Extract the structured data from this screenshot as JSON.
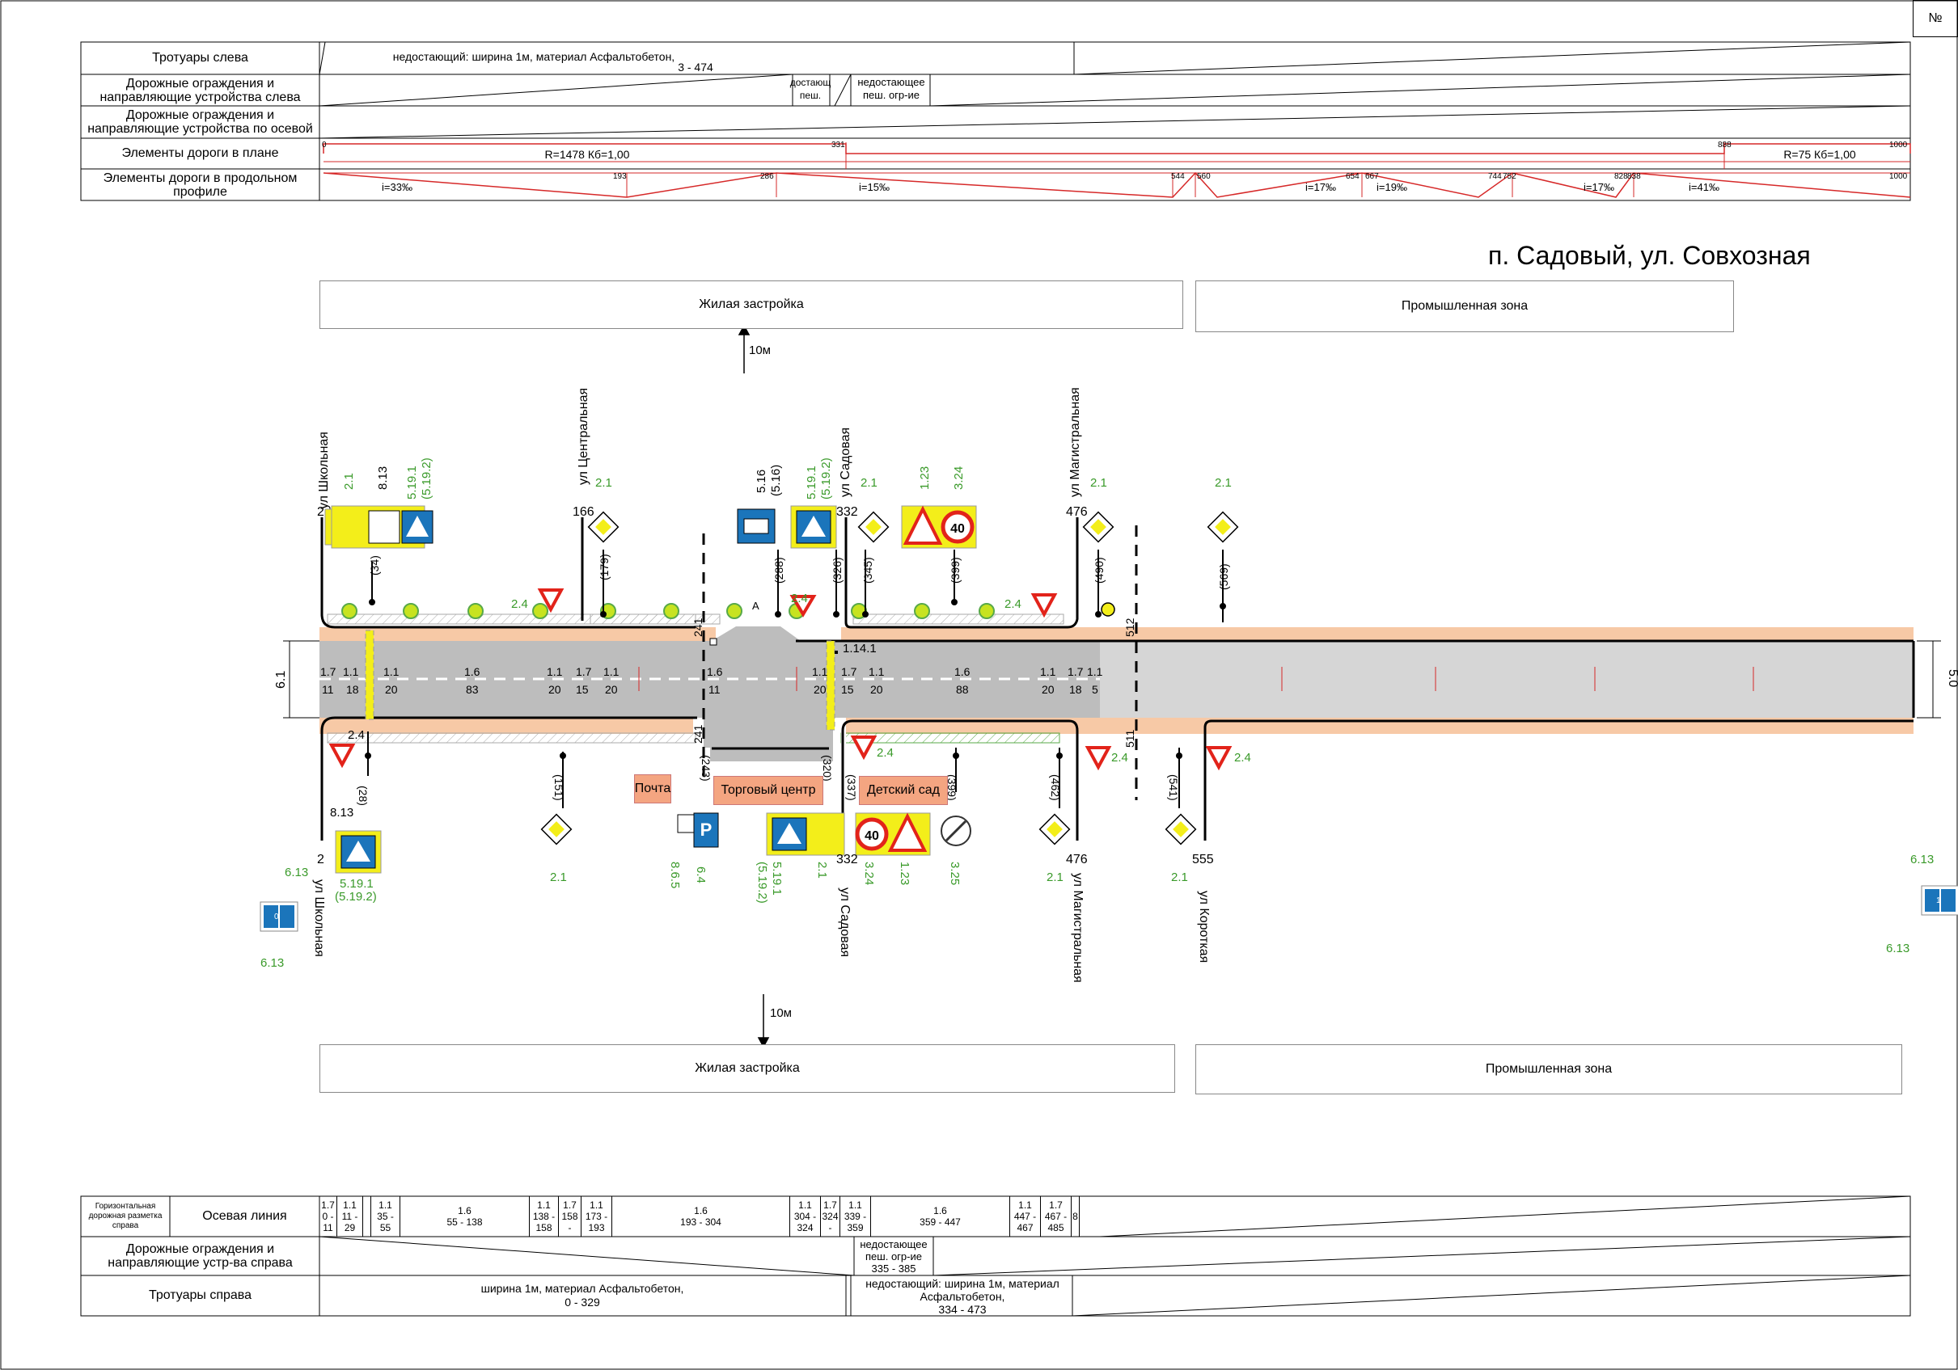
{
  "corner_number": "№",
  "title": "п. Садовый, ул. Совхозная",
  "top_table": {
    "rows": [
      {
        "label": "Тротуары слева"
      },
      {
        "label": "Дорожные ограждения и направляющие устройства слева"
      },
      {
        "label": "Дорожные ограждения и направляющие устройства по осевой"
      },
      {
        "label": "Элементы дороги в плане"
      },
      {
        "label": "Элементы дороги в продольном профиле"
      }
    ],
    "sidewalk_left_text_1": "недостающий: ширина 1м, материал Асфальтобетон,",
    "sidewalk_left_text_2": "3 - 474",
    "barrier_left_a_1": "достающ",
    "barrier_left_a_2": "пеш.",
    "barrier_left_b_1": "недостающее",
    "barrier_left_b_2": "пеш. огр-ие",
    "plan_ticks": [
      "0",
      "331",
      "888",
      "1000"
    ],
    "plan_curve_1": "R=1478   Кб=1,00",
    "plan_curve_2": "R=75   Кб=1,00",
    "profile_ticks": [
      "193",
      "286",
      "544",
      "560",
      "654",
      "667",
      "744",
      "752",
      "828",
      "838",
      "1000"
    ],
    "profile_grades": [
      "i=33‰",
      "i=15‰",
      "i=17‰",
      "i=19‰",
      "i=17‰",
      "i=41‰"
    ]
  },
  "zones": {
    "top_left": "Жилая застройка",
    "top_right": "Промышленная зона",
    "bottom_left": "Жилая застройка",
    "bottom_right": "Промышленная зона",
    "distance_top": "10м",
    "distance_bottom": "10м"
  },
  "streets": {
    "shkolnaya": "ул Школьная",
    "centralnaya": "ул Центральная",
    "sadovaya": "ул Садовая",
    "magistralnaya": "ул Магистральная",
    "korotkaya": "ул Короткая"
  },
  "buildings": {
    "pochta": "Почта",
    "torgoviy": "Торговый центр",
    "detsad": "Детский сад"
  },
  "widths": {
    "left": "6.1",
    "right": "5.0"
  },
  "km_marks": {
    "a": "2",
    "b": "166",
    "c": "332",
    "d": "476",
    "e": "555"
  },
  "sign_codes": {
    "s21": "2.1",
    "s24": "2.4",
    "s813": "8.13",
    "s5191": "5.19.1",
    "s5192": "(5.19.2)",
    "s516": "5.16",
    "s516b": "(5.16)",
    "s123": "1.23",
    "s324": "3.24",
    "s325": "3.25",
    "s64": "6.4",
    "s865": "8.6.5",
    "s613": "6.13",
    "s1141": "1.14.1",
    "sA": "A"
  },
  "positions_top": [
    "(34)",
    "(179)",
    "(288)",
    "(326)",
    "(345)",
    "(399)",
    "(490)",
    "(569)"
  ],
  "positions_bottom": [
    "(28)",
    "(151)",
    "(243)",
    "(320)",
    "(337)",
    "(399)",
    "(462)",
    "(541)"
  ],
  "marking_labels": {
    "m17": "1.7",
    "m11": "1.1",
    "m16": "1.6",
    "n11": "11",
    "n18": "18",
    "n20": "20",
    "n83": "83",
    "n15": "15",
    "n88": "88",
    "n5": "5",
    "n241": "241",
    "n512": "512",
    "n511": "511"
  },
  "bottom_table": {
    "row1_title_small": "Горизонтальная дорожная разметка справа",
    "row1_title": "Осевая линия",
    "row1_cells": [
      {
        "a": "1.7",
        "b": "0 -",
        "c": "11"
      },
      {
        "a": "1.1",
        "b": "11 -",
        "c": "29"
      },
      {
        "a": "1.1",
        "b": "35 -",
        "c": "55"
      },
      {
        "a": "1.6",
        "b": "55 - 138",
        "c": ""
      },
      {
        "a": "1.1",
        "b": "138 -",
        "c": "158"
      },
      {
        "a": "1.7",
        "b": "158",
        "c": "-"
      },
      {
        "a": "1.1",
        "b": "173 -",
        "c": "193"
      },
      {
        "a": "1.6",
        "b": "193 - 304",
        "c": ""
      },
      {
        "a": "1.1",
        "b": "304 -",
        "c": "324"
      },
      {
        "a": "1.7",
        "b": "324",
        "c": "-"
      },
      {
        "a": "1.1",
        "b": "339 -",
        "c": "359"
      },
      {
        "a": "1.6",
        "b": "359 - 447",
        "c": ""
      },
      {
        "a": "1.1",
        "b": "447 -",
        "c": "467"
      },
      {
        "a": "1.7",
        "b": "467 -",
        "c": "485"
      },
      {
        "a": "",
        "b": "",
        "c": "8"
      }
    ],
    "row2_title": "Дорожные ограждения и направляющие устр-ва справа",
    "row2_text_1": "недостающее",
    "row2_text_2": "пеш. огр-ие",
    "row2_text_3": "335 - 385",
    "row3_title": "Тротуары справа",
    "row3_text_1": "ширина 1м, материал Асфальтобетон,",
    "row3_text_2": "0 - 329",
    "row3_text_3": "недостающий: ширина 1м, материал",
    "row3_text_4": "Асфальтобетон,",
    "row3_text_5": "334 - 473"
  },
  "colors": {
    "road": "#bdbdbd",
    "road_light": "#d6d6d6",
    "sidewalk": "#f7c9a6",
    "sign_yellow": "#f3ee1a",
    "sign_blue": "#1b75bb",
    "sign_red": "#e2231a",
    "profile_red": "#d62828",
    "label_green": "#3a9a2a"
  }
}
